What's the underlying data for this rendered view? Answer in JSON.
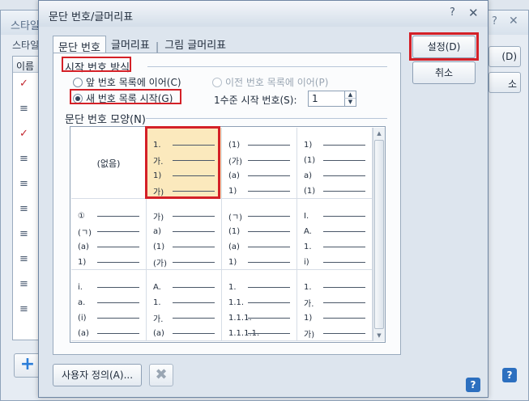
{
  "background": {
    "title": "스타일",
    "style_label": "스타일",
    "list_header": "이름",
    "rows": [
      "✓",
      "≡",
      "✓",
      "≡",
      "≡",
      "≡",
      "≡",
      "≡",
      "≡",
      "≡"
    ],
    "button1": "(D)",
    "button2": "소",
    "help": "?",
    "add": "+"
  },
  "dialog": {
    "title": "문단 번호/글머리표",
    "help_icon": "?",
    "close_icon": "✕",
    "tabs": [
      {
        "label": "문단 번호",
        "active": true
      },
      {
        "label": "글머리표",
        "active": false
      },
      {
        "label": "그림 글머리표",
        "active": false
      }
    ],
    "tab_separator": "|",
    "section_start": {
      "label": "시작 번호 방식",
      "options": [
        {
          "label": "앞 번호 목록에 이어(C)",
          "checked": false,
          "enabled": true
        },
        {
          "label": "새 번호 목록 시작(G)",
          "checked": true,
          "enabled": true
        },
        {
          "label": "이전 번호 목록에 이어(P)",
          "checked": false,
          "enabled": false
        }
      ],
      "level_start_label": "1수준 시작 번호(S):",
      "level_start_value": "1",
      "spin_up": "▲",
      "spin_down": "▼"
    },
    "section_shape": {
      "label": "문단 번호 모양(N)",
      "none_label": "(없음)",
      "selected_index": 1,
      "cells": [
        {
          "markers": []
        },
        {
          "markers": [
            "1.",
            "가.",
            "1)",
            "가)"
          ]
        },
        {
          "markers": [
            "(1)",
            "(가)",
            "(a)",
            "1)"
          ]
        },
        {
          "markers": [
            "1)",
            "(1)",
            "a)",
            "(1)"
          ]
        },
        {
          "markers": [
            "①",
            "(ㄱ)",
            "(a)",
            "1)"
          ]
        },
        {
          "markers": [
            "가)",
            "a)",
            "(1)",
            "(가)"
          ]
        },
        {
          "markers": [
            "(ㄱ)",
            "(1)",
            "(a)",
            "1)"
          ]
        },
        {
          "markers": [
            "I.",
            "A.",
            "1.",
            "i)"
          ]
        },
        {
          "markers": [
            "i.",
            "a.",
            "(i)",
            "(a)"
          ]
        },
        {
          "markers": [
            "A.",
            "1.",
            "가.",
            "(a)"
          ]
        },
        {
          "markers": [
            "1.",
            "1.1.",
            "1.1.1.",
            "1.1.1.1."
          ]
        },
        {
          "markers": [
            "1.",
            "가.",
            "1)",
            "가)"
          ]
        }
      ],
      "scroll_up": "▲",
      "scroll_down": "▼"
    },
    "custom_button": "사용자 정의(A)...",
    "delete_icon": "✖",
    "ok_button": "설정(D)",
    "cancel_button": "취소",
    "help_button": "?"
  }
}
